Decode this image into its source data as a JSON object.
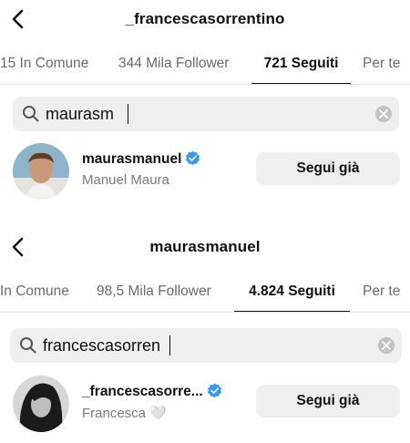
{
  "panels": [
    {
      "title": "_francescasorrentino",
      "tabs": [
        {
          "label": "15 In Comune",
          "active": false
        },
        {
          "label": "344 Mila Follower",
          "active": false
        },
        {
          "label": "721 Seguiti",
          "active": true
        },
        {
          "label": "Per te",
          "active": false
        }
      ],
      "search": {
        "value": "maurasm"
      },
      "result": {
        "username": "maurasmanuel",
        "verified": true,
        "fullname": "Manuel Maura",
        "button_label": "Segui già"
      }
    },
    {
      "title": "maurasmanuel",
      "tabs": [
        {
          "label": "In Comune",
          "active": false
        },
        {
          "label": "98,5 Mila Follower",
          "active": false
        },
        {
          "label": "4.824 Seguiti",
          "active": true
        },
        {
          "label": "Per te",
          "active": false
        }
      ],
      "search": {
        "value": "francescasorren"
      },
      "result": {
        "username": "_francescasorre...",
        "verified": true,
        "fullname": "Francesca 🤍",
        "button_label": "Segui già"
      }
    }
  ],
  "colors": {
    "verified_badge": "#3897f0",
    "field_bg": "#efefef",
    "secondary_text": "#7a7a7a"
  }
}
